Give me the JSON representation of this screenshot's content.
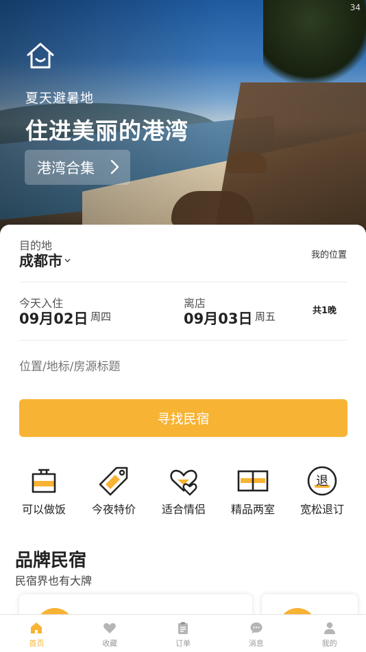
{
  "hero": {
    "status_number": "34",
    "subtitle": "夏天避暑地",
    "title": "住进美丽的港湾",
    "collection_button": "港湾合集"
  },
  "search": {
    "destination_label": "目的地",
    "destination_city": "成都市",
    "my_location": "我的位置",
    "checkin_label": "今天入住",
    "checkin_date": "09月02日",
    "checkin_weekday": "周四",
    "checkout_label": "离店",
    "checkout_date": "09月03日",
    "checkout_weekday": "周五",
    "nights": "共1晚",
    "keyword_placeholder": "位置/地标/房源标题",
    "submit": "寻找民宿"
  },
  "categories": [
    {
      "label": "可以做饭",
      "icon": "cooking-pot-icon"
    },
    {
      "label": "今夜特价",
      "icon": "price-tag-icon"
    },
    {
      "label": "适合情侣",
      "icon": "hearts-icon"
    },
    {
      "label": "精品两室",
      "icon": "two-rooms-icon"
    },
    {
      "label": "宽松退订",
      "icon": "refund-icon"
    }
  ],
  "category_icon_glyph": "退",
  "brand": {
    "title": "品牌民宿",
    "subtitle": "民宿界也有大牌"
  },
  "tabs": [
    {
      "label": "首页",
      "icon": "home-icon",
      "active": true
    },
    {
      "label": "收藏",
      "icon": "heart-icon",
      "active": false
    },
    {
      "label": "订单",
      "icon": "clipboard-icon",
      "active": false
    },
    {
      "label": "消息",
      "icon": "chat-icon",
      "active": false
    },
    {
      "label": "我的",
      "icon": "user-icon",
      "active": false
    }
  ],
  "colors": {
    "accent": "#f7b334",
    "text_dark": "#222222",
    "tab_inactive": "#9a9a9a"
  }
}
